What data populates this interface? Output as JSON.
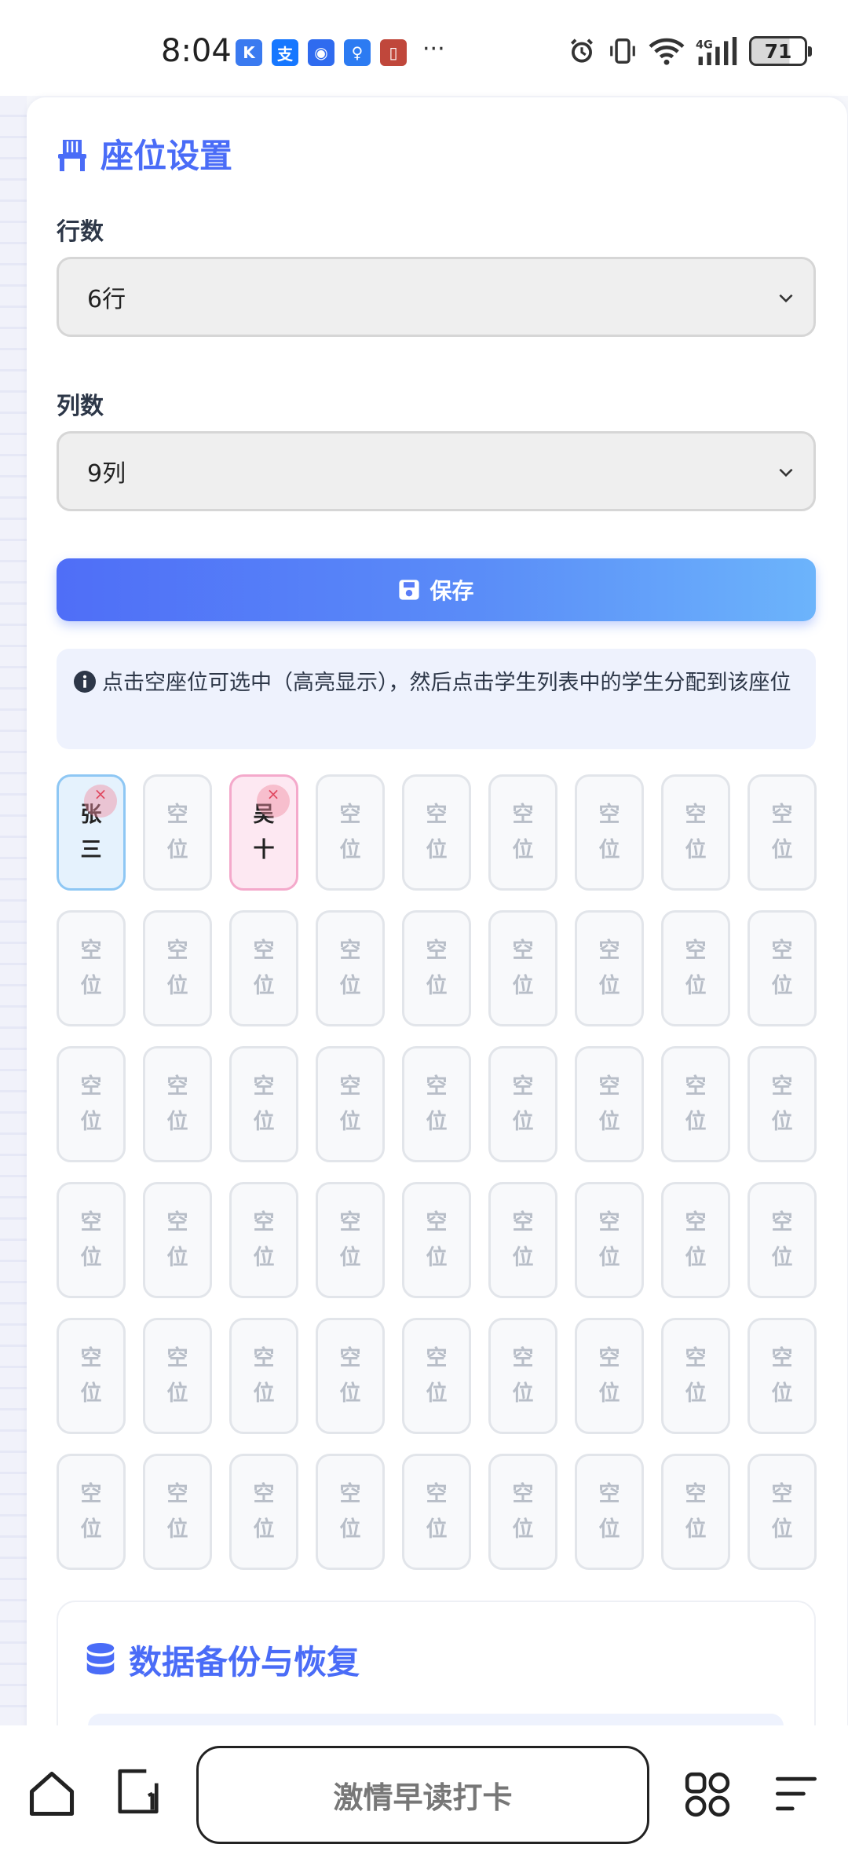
{
  "status_bar": {
    "time": "8:04",
    "apps": [
      {
        "name": "k-app-icon",
        "glyph": "K",
        "color": "#3a7af0"
      },
      {
        "name": "alipay-icon",
        "glyph": "支",
        "color": "#1677ff"
      },
      {
        "name": "browser-icon",
        "glyph": "◉",
        "color": "#2f6bef"
      },
      {
        "name": "bulb-icon",
        "glyph": "♀",
        "color": "#2c7bf2"
      },
      {
        "name": "book-icon",
        "glyph": "▯",
        "color": "#c0473b"
      }
    ],
    "more": "···",
    "battery_level": "71"
  },
  "seat_settings": {
    "title": "座位设置",
    "rows_label": "行数",
    "rows_value": "6行",
    "cols_label": "列数",
    "cols_value": "9列",
    "save_label": "保存",
    "info_text": "点击空座位可选中（高亮显示），然后点击学生列表中的学生分配到该座位"
  },
  "seats": {
    "rows": 6,
    "cols": 9,
    "empty_label": "空位",
    "remove_glyph": "×",
    "assigned": [
      {
        "row": 0,
        "col": 0,
        "name": "张三",
        "style": "blue"
      },
      {
        "row": 0,
        "col": 2,
        "name": "吴十",
        "style": "pink"
      }
    ]
  },
  "backup": {
    "title": "数据备份与恢复"
  },
  "bottom_nav": {
    "main_label": "激情早读打卡"
  },
  "colors": {
    "accent": "#4a6cf7",
    "seat_blue": "#8ec7f4",
    "seat_pink": "#f4a9cb"
  }
}
